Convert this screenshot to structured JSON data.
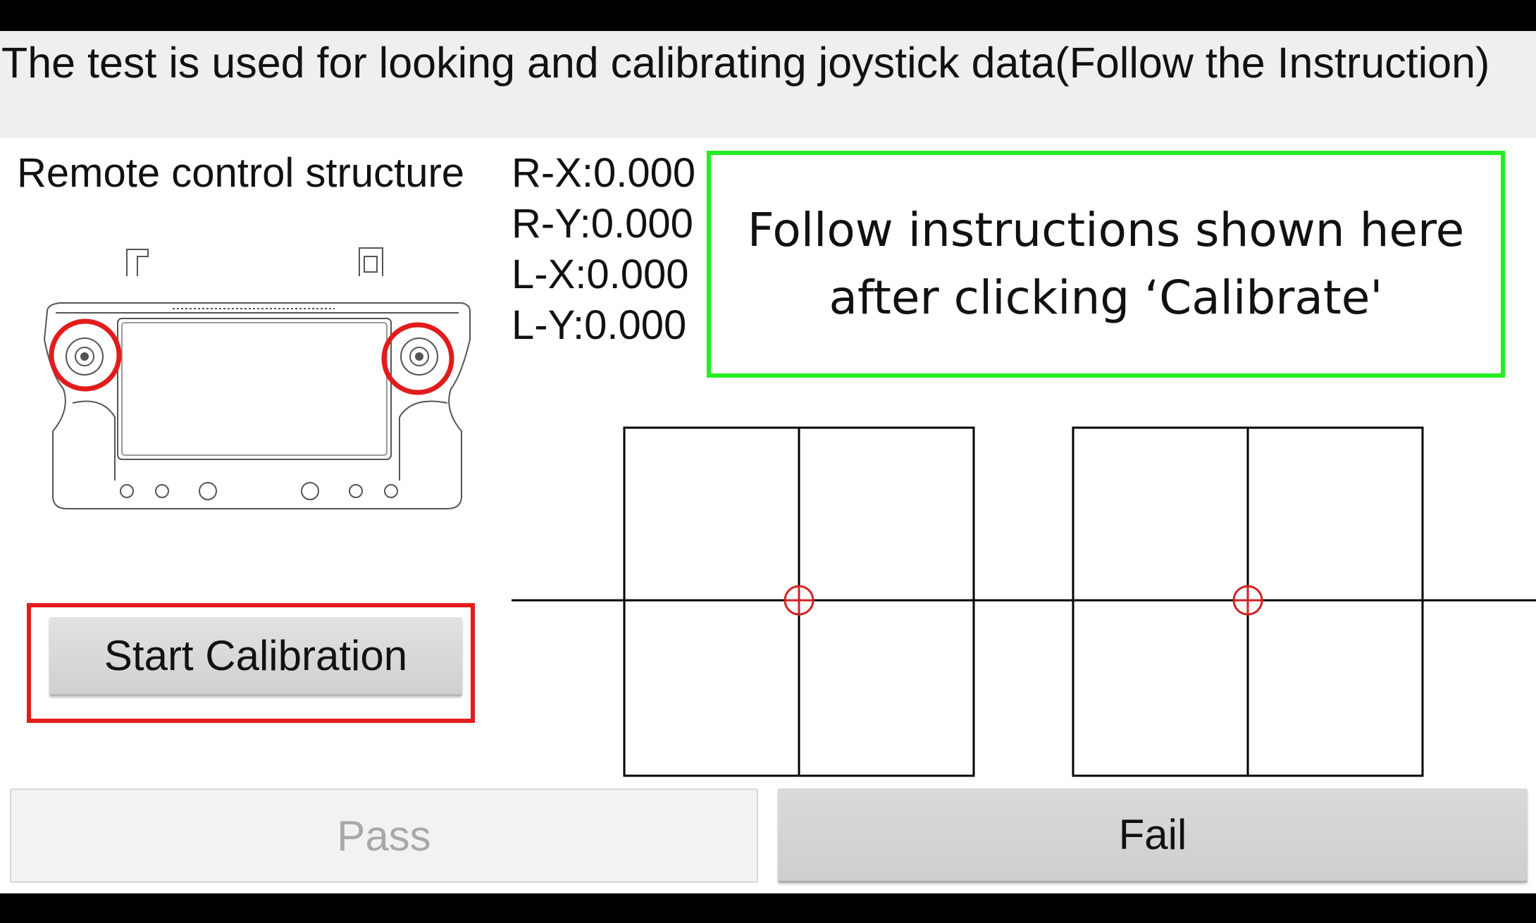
{
  "header": {
    "description": "The test is used for looking and calibrating joystick data(Follow the Instruction)"
  },
  "remote": {
    "title": "Remote control structure"
  },
  "readouts": {
    "rx": "R-X:0.000",
    "ry": "R-Y:0.000",
    "lx": "L-X:0.000",
    "ly": "L-Y:0.000"
  },
  "instructions": {
    "line1": "Follow instructions shown here",
    "line2": "after clicking ‘Calibrate'"
  },
  "buttons": {
    "start_calibration": "Start Calibration",
    "pass": "Pass",
    "fail": "Fail"
  },
  "joysticks": {
    "left": {
      "x": 0,
      "y": 0
    },
    "right": {
      "x": 0,
      "y": 0
    }
  },
  "colors": {
    "highlight_red": "#e21c1c",
    "instruction_border": "#22ee22",
    "joystick_marker": "#d42020"
  }
}
